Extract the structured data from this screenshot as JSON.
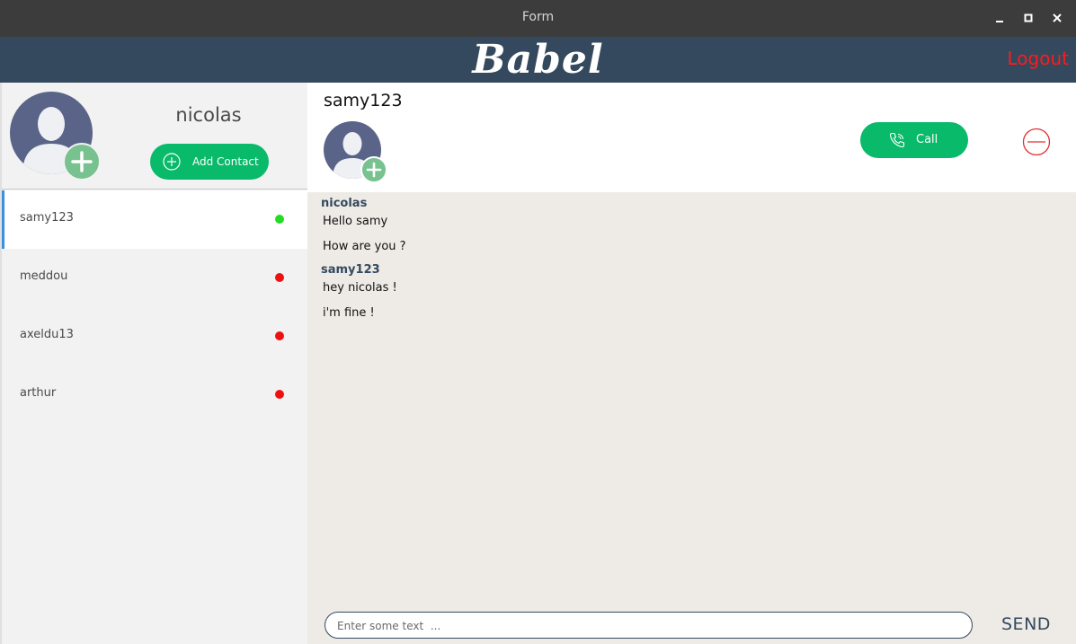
{
  "window": {
    "title": "Form",
    "controls": [
      "minimize-icon",
      "maximize-icon",
      "close-icon"
    ]
  },
  "header": {
    "brand": "Babel",
    "logout_label": "Logout"
  },
  "sidebar": {
    "current_user": "nicolas",
    "add_contact_label": "Add Contact",
    "contacts": [
      {
        "name": "samy123",
        "status": "online",
        "active": true
      },
      {
        "name": "meddou",
        "status": "offline",
        "active": false
      },
      {
        "name": "axeldu13",
        "status": "offline",
        "active": false
      },
      {
        "name": "arthur",
        "status": "offline",
        "active": false
      }
    ]
  },
  "chat": {
    "contact_name": "samy123",
    "call_label": "Call",
    "messages": [
      {
        "sender": "nicolas",
        "lines": [
          "Hello samy",
          "How are you ?"
        ]
      },
      {
        "sender": "samy123",
        "lines": [
          "hey nicolas !",
          "i'm fine !"
        ]
      }
    ],
    "input_placeholder": "Enter some text  ...",
    "send_label": "SEND"
  },
  "colors": {
    "header_bg": "#34495e",
    "accent_green": "#08ba6a",
    "avatar_badge": "#77c28f",
    "online": "#22dd22",
    "offline": "#ee1111",
    "logout": "#ff1a1a",
    "active_indicator": "#3d8fe0"
  }
}
